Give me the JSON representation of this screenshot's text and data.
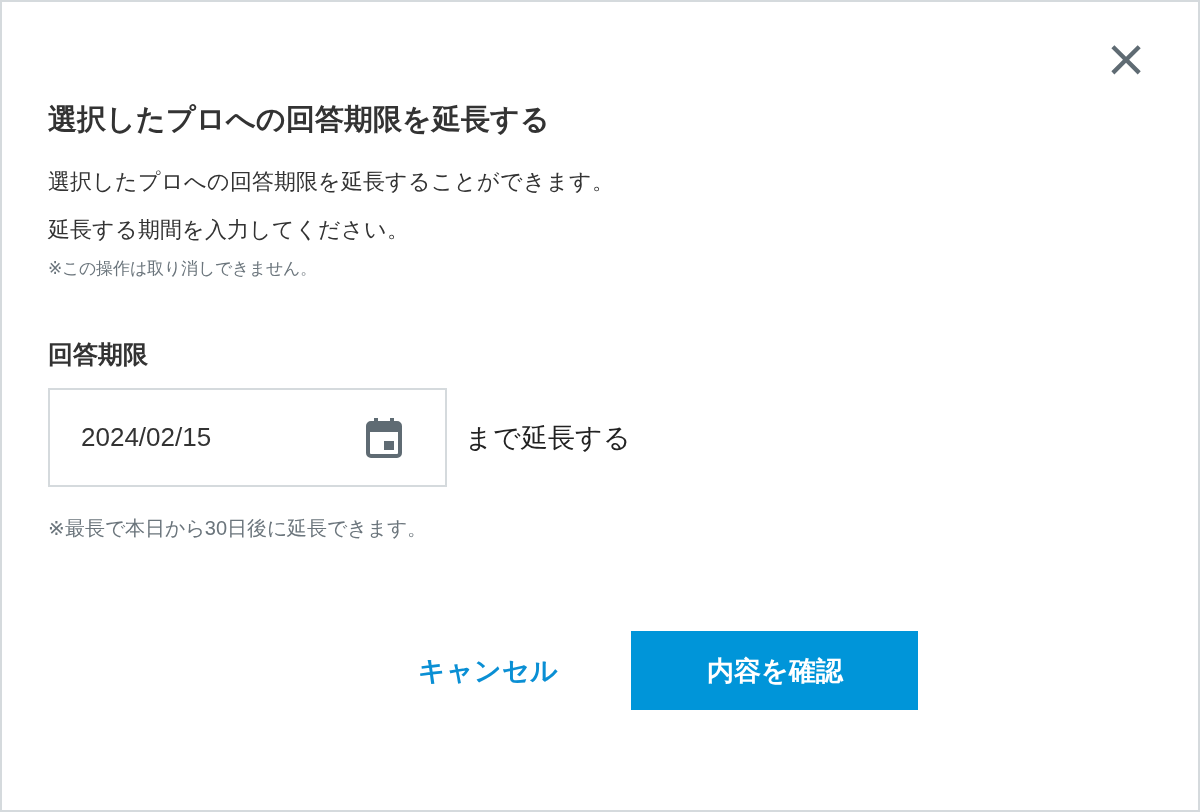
{
  "dialog": {
    "close_label": "×",
    "title": "選択したプロへの回答期限を延長する",
    "description": [
      "選択したプロへの回答期限を延長することができます。",
      "延長する期間を入力してください。"
    ],
    "warning": "※この操作は取り消しできません。",
    "field": {
      "label": "回答期限",
      "value": "2024/02/15",
      "suffix": "まで延長する",
      "hint": "※最長で本日から30日後に延長できます。"
    },
    "buttons": [
      {
        "kind": "text",
        "label": "キャンセル"
      },
      {
        "kind": "primary",
        "label": "内容を確認"
      }
    ]
  }
}
